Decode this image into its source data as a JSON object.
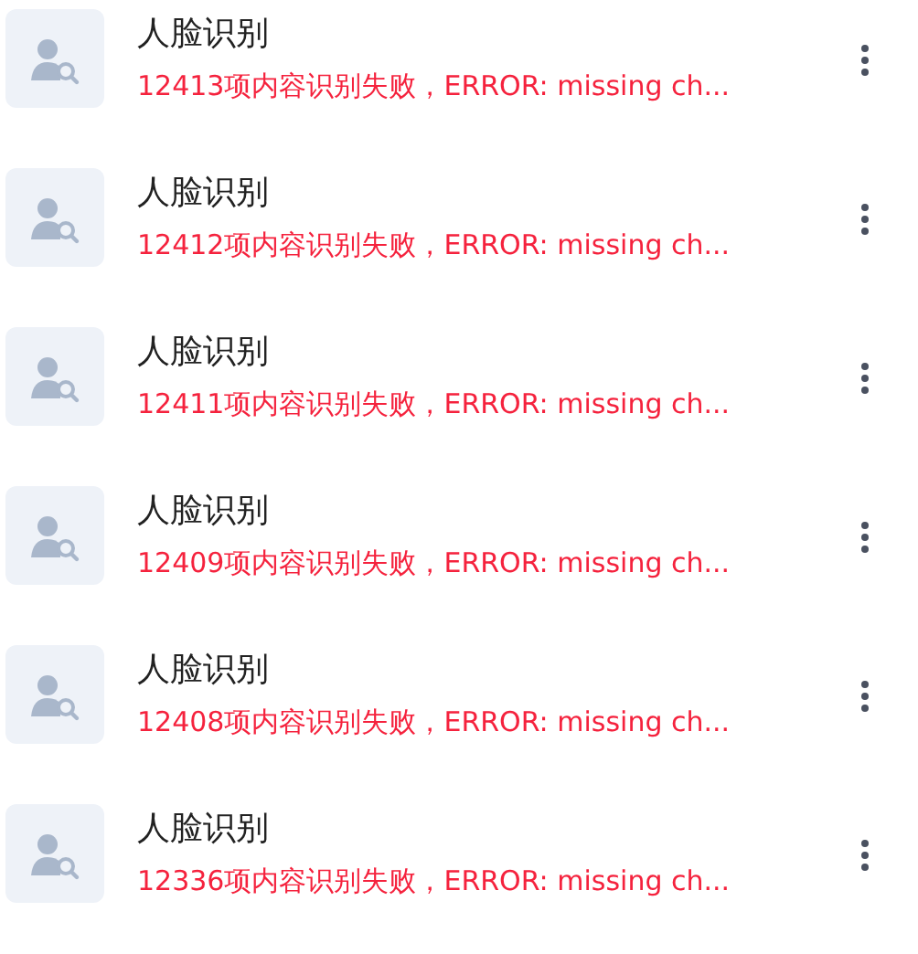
{
  "items": [
    {
      "title": "人脸识别",
      "message": "12413项内容识别失败，ERROR: missing ch..."
    },
    {
      "title": "人脸识别",
      "message": "12412项内容识别失败，ERROR: missing ch..."
    },
    {
      "title": "人脸识别",
      "message": "12411项内容识别失败，ERROR: missing ch..."
    },
    {
      "title": "人脸识别",
      "message": "12409项内容识别失败，ERROR: missing ch..."
    },
    {
      "title": "人脸识别",
      "message": "12408项内容识别失败，ERROR: missing ch..."
    },
    {
      "title": "人脸识别",
      "message": "12336项内容识别失败，ERROR: missing ch..."
    }
  ]
}
